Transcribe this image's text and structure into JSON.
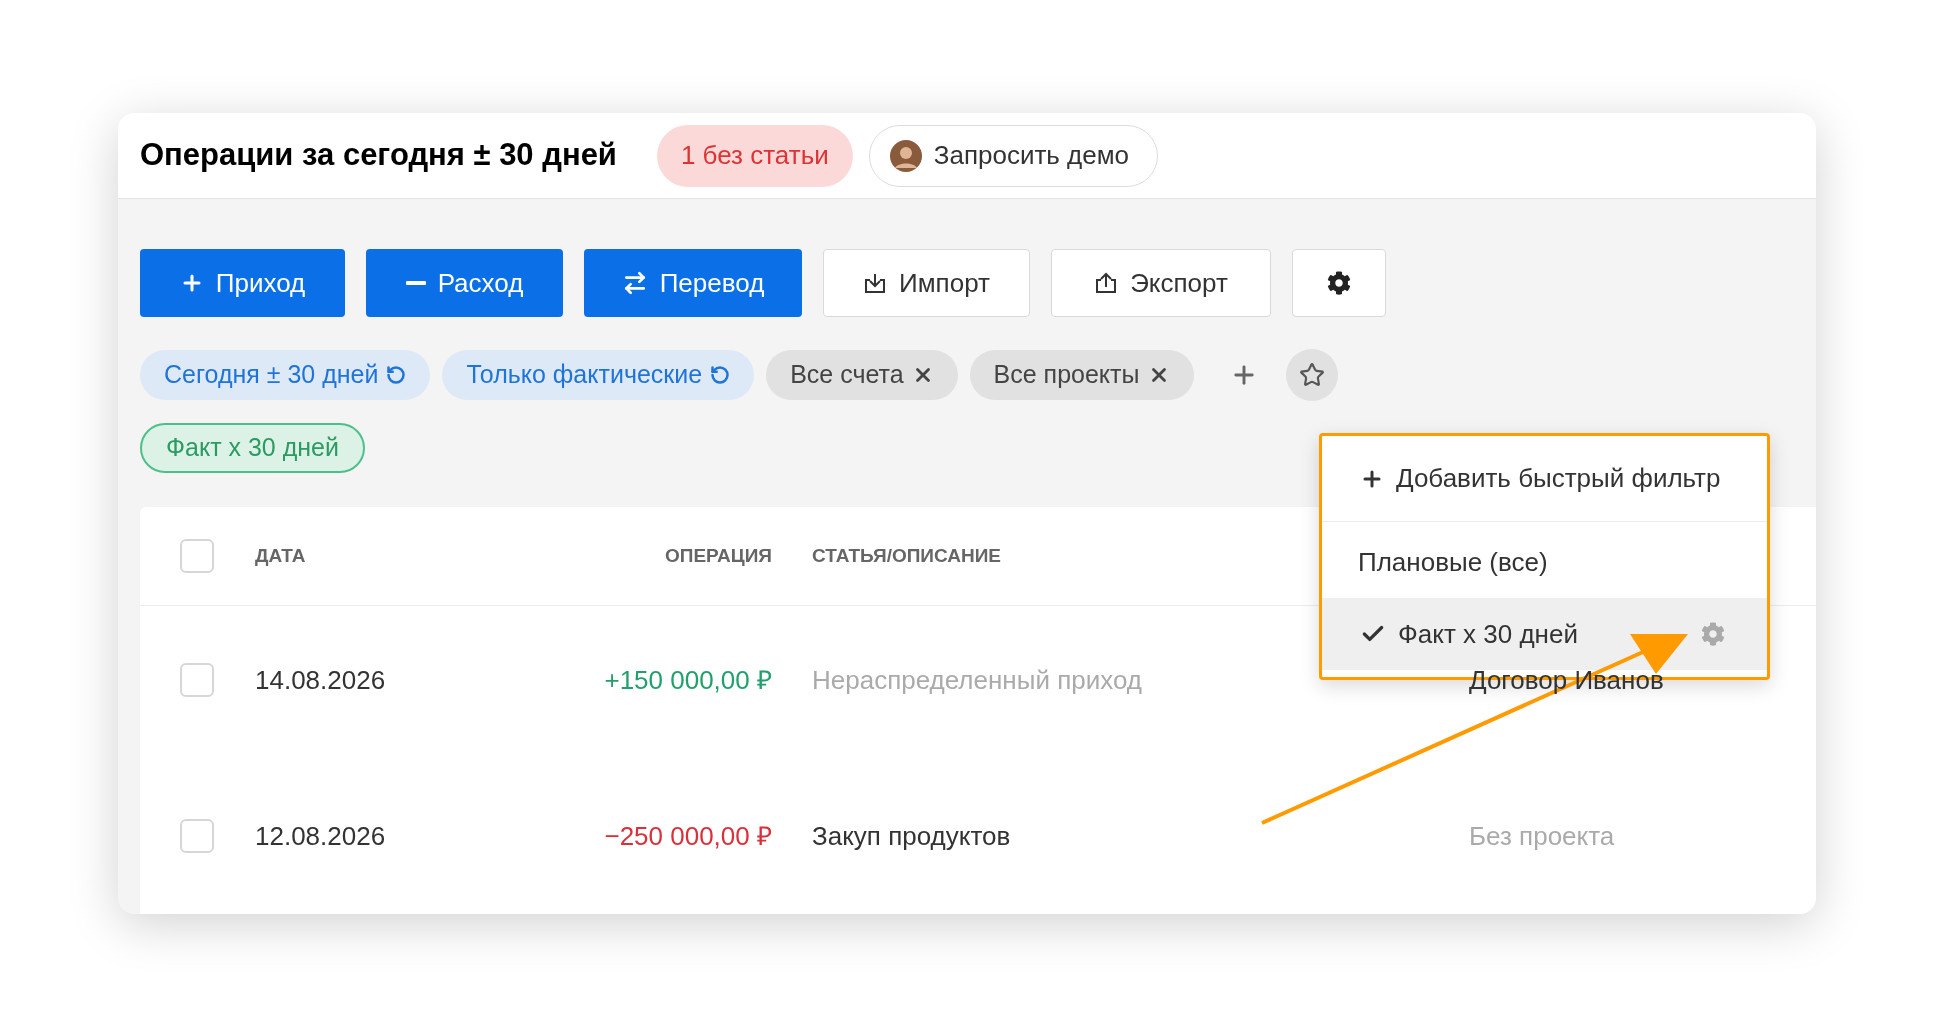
{
  "header": {
    "title": "Операции за сегодня ± 30 дней",
    "badge": "1 без статьи",
    "demo_button": "Запросить демо"
  },
  "toolbar": [
    {
      "label": "Приход",
      "kind": "income"
    },
    {
      "label": "Расход",
      "kind": "expense"
    },
    {
      "label": "Перевод",
      "kind": "transfer"
    },
    {
      "label": "Импорт",
      "kind": "import"
    },
    {
      "label": "Экспорт",
      "kind": "export"
    },
    {
      "kind": "settings"
    }
  ],
  "filters": [
    {
      "label": "Сегодня ± 30 дней",
      "kind": "reset"
    },
    {
      "label": "Только фактические",
      "kind": "reset"
    },
    {
      "label": "Все счета",
      "kind": "remove"
    },
    {
      "label": "Все проекты",
      "kind": "remove"
    }
  ],
  "saved_filters": [
    {
      "label": "Факт х 30 дней"
    }
  ],
  "table": {
    "select_all_checked": false,
    "columns": [
      "ДАТА",
      "ОПЕРАЦИЯ",
      "СТАТЬЯ/ОПИСАНИЕ"
    ],
    "rows": [
      {
        "checked": false,
        "date": "14.08.2026",
        "amount": "+150 000,00 ₽",
        "kind": "income",
        "description": "Нераспределенный приход",
        "uncategorized": true,
        "project": "Договор Иванов",
        "no_project": false
      },
      {
        "checked": false,
        "date": "12.08.2026",
        "amount": "−250 000,00 ₽",
        "kind": "expense",
        "description": "Закуп продуктов",
        "uncategorized": false,
        "project": "Без проекта",
        "no_project": true
      }
    ]
  },
  "quick_filter_menu": {
    "add_label": "Добавить быстрый фильтр",
    "items": [
      {
        "label": "Плановые (все)",
        "selected": false
      },
      {
        "label": "Факт х 30 дней",
        "selected": true
      }
    ]
  }
}
